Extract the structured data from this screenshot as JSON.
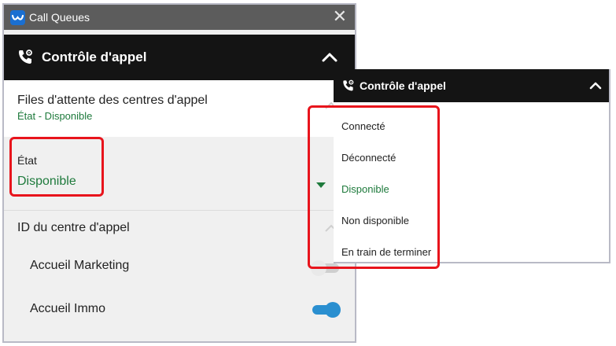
{
  "window": {
    "title": "Call Queues",
    "close_glyph": "✕"
  },
  "section": {
    "title": "Contrôle d'appel"
  },
  "queues": {
    "title": "Files d'attente des centres d'appel",
    "status": "État - Disponible"
  },
  "state": {
    "label": "État",
    "value": "Disponible"
  },
  "call_centre": {
    "label": "ID du centre d'appel"
  },
  "call_centres": [
    {
      "name": "Accueil Marketing",
      "enabled": false
    },
    {
      "name": "Accueil Immo",
      "enabled": true
    }
  ],
  "dropdown": {
    "title": "Contrôle d'appel",
    "options": [
      "Connecté",
      "Déconnecté",
      "Disponible",
      "Non disponible",
      "En train de terminer"
    ],
    "selected": "Disponible"
  },
  "colors": {
    "accent_green": "#1e7a3c",
    "highlight_red": "#e8141c",
    "toggle_blue": "#2a8fd0",
    "header_dark": "#141414",
    "titlebar_grey": "#5c5c5c"
  },
  "icons": {
    "app": "webex-logo-icon",
    "section": "phone-settings-icon",
    "collapse": "chevron-up-icon",
    "expand_state": "caret-down-icon"
  }
}
